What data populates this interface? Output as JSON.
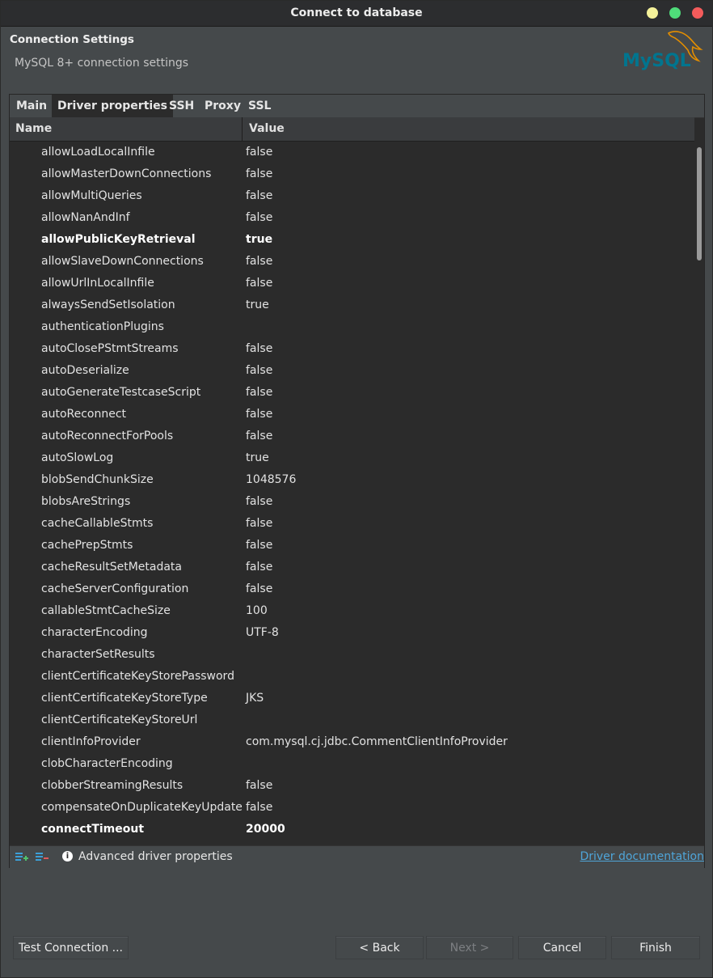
{
  "window": {
    "title": "Connect to database"
  },
  "header": {
    "title": "Connection Settings",
    "subtitle": "MySQL 8+ connection settings",
    "logo_text": "MySQL"
  },
  "tabs": [
    {
      "label": "Main"
    },
    {
      "label": "Driver properties"
    },
    {
      "label": "SSH"
    },
    {
      "label": "Proxy"
    },
    {
      "label": "SSL"
    }
  ],
  "active_tab": "Driver properties",
  "table": {
    "columns": {
      "name": "Name",
      "value": "Value"
    },
    "rows": [
      {
        "name": "allowLoadLocalInfile",
        "value": "false"
      },
      {
        "name": "allowMasterDownConnections",
        "value": "false"
      },
      {
        "name": "allowMultiQueries",
        "value": "false"
      },
      {
        "name": "allowNanAndInf",
        "value": "false"
      },
      {
        "name": "allowPublicKeyRetrieval",
        "value": "true",
        "bold": true
      },
      {
        "name": "allowSlaveDownConnections",
        "value": "false"
      },
      {
        "name": "allowUrlInLocalInfile",
        "value": "false"
      },
      {
        "name": "alwaysSendSetIsolation",
        "value": "true"
      },
      {
        "name": "authenticationPlugins",
        "value": ""
      },
      {
        "name": "autoClosePStmtStreams",
        "value": "false"
      },
      {
        "name": "autoDeserialize",
        "value": "false"
      },
      {
        "name": "autoGenerateTestcaseScript",
        "value": "false"
      },
      {
        "name": "autoReconnect",
        "value": "false"
      },
      {
        "name": "autoReconnectForPools",
        "value": "false"
      },
      {
        "name": "autoSlowLog",
        "value": "true"
      },
      {
        "name": "blobSendChunkSize",
        "value": "1048576"
      },
      {
        "name": "blobsAreStrings",
        "value": "false"
      },
      {
        "name": "cacheCallableStmts",
        "value": "false"
      },
      {
        "name": "cachePrepStmts",
        "value": "false"
      },
      {
        "name": "cacheResultSetMetadata",
        "value": "false"
      },
      {
        "name": "cacheServerConfiguration",
        "value": "false"
      },
      {
        "name": "callableStmtCacheSize",
        "value": "100"
      },
      {
        "name": "characterEncoding",
        "value": "UTF-8"
      },
      {
        "name": "characterSetResults",
        "value": ""
      },
      {
        "name": "clientCertificateKeyStorePassword",
        "value": ""
      },
      {
        "name": "clientCertificateKeyStoreType",
        "value": "JKS"
      },
      {
        "name": "clientCertificateKeyStoreUrl",
        "value": ""
      },
      {
        "name": "clientInfoProvider",
        "value": "com.mysql.cj.jdbc.CommentClientInfoProvider"
      },
      {
        "name": "clobCharacterEncoding",
        "value": ""
      },
      {
        "name": "clobberStreamingResults",
        "value": "false"
      },
      {
        "name": "compensateOnDuplicateKeyUpdateCounts",
        "value": "false"
      },
      {
        "name": "connectTimeout",
        "value": "20000",
        "bold": true
      }
    ]
  },
  "footer": {
    "add_icon": "add-property-icon",
    "remove_icon": "remove-property-icon",
    "info_icon": "info-icon",
    "advanced_label": "Advanced driver properties",
    "doc_link": "Driver documentation"
  },
  "buttons": {
    "test": "Test Connection ...",
    "back": "< Back",
    "next": "Next >",
    "cancel": "Cancel",
    "finish": "Finish"
  },
  "colors": {
    "link": "#4fa5d9",
    "close": "#f45b5b",
    "maximize": "#4fdc7a",
    "minimize": "#f4f19a"
  }
}
